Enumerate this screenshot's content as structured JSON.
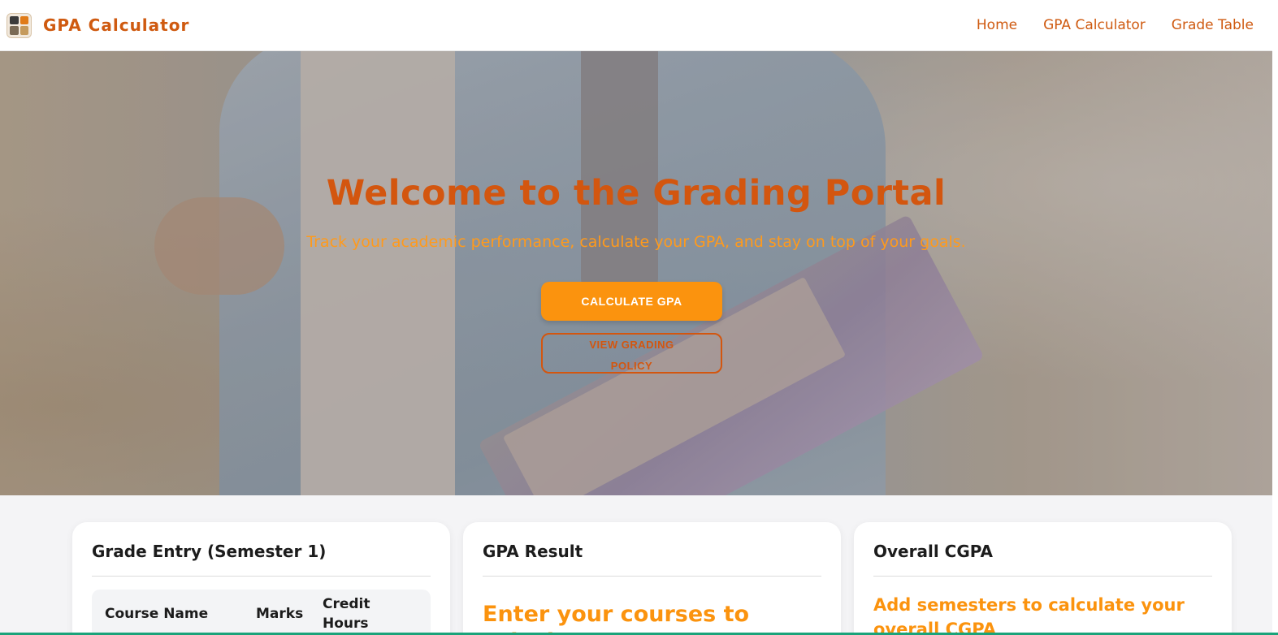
{
  "navbar": {
    "brand": "GPA Calculator",
    "links": [
      {
        "label": "Home"
      },
      {
        "label": "GPA Calculator"
      },
      {
        "label": "Grade Table"
      }
    ]
  },
  "hero": {
    "title": "Welcome to the Grading Portal",
    "subtitle": "Track your academic performance, calculate your GPA, and stay on top of your goals.",
    "primary_button": "CALCULATE GPA",
    "secondary_button": "VIEW GRADING POLICY"
  },
  "grade_entry": {
    "title": "Grade Entry (Semester 1)",
    "columns": [
      "Course Name",
      "Marks",
      "Credit Hours"
    ]
  },
  "gpa_result": {
    "title": "GPA Result",
    "message": "Enter your courses to calculate"
  },
  "overall_cgpa": {
    "title": "Overall CGPA",
    "message": "Add semesters to calculate your overall CGPA"
  },
  "colors": {
    "accent": "#cf5a10",
    "primary_button": "#fb930e",
    "subtitle": "#ff9a1c"
  }
}
